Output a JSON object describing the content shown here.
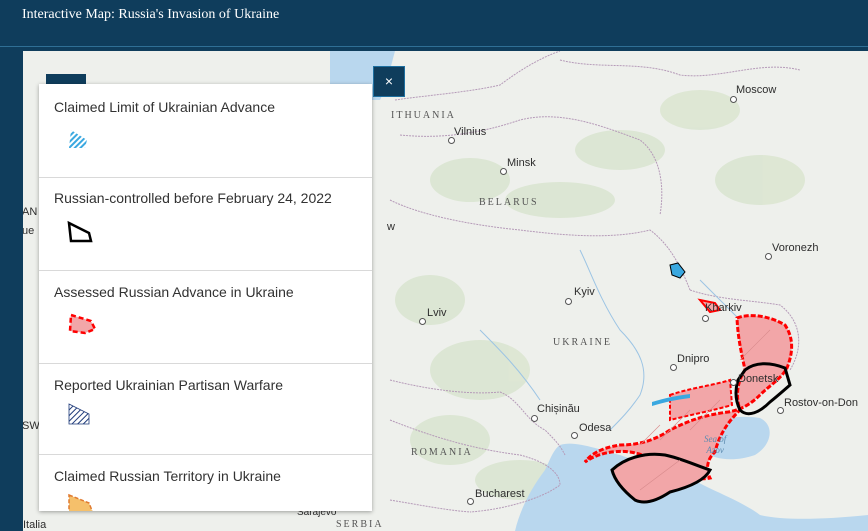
{
  "header": {
    "title": "Interactive Map: Russia's Invasion of Ukraine"
  },
  "legend": {
    "close_label": "×",
    "items": [
      {
        "label": "Claimed Limit of Ukrainian Advance",
        "swatch": "blue-hatched"
      },
      {
        "label": "Russian-controlled before February 24, 2022",
        "swatch": "black-outline"
      },
      {
        "label": "Assessed Russian Advance in Ukraine",
        "swatch": "red-fill"
      },
      {
        "label": "Reported Ukrainian Partisan Warfare",
        "swatch": "navy-hatched"
      },
      {
        "label": "Claimed Russian Territory in Ukraine",
        "swatch": "orange-fill"
      }
    ]
  },
  "map": {
    "cities": {
      "moscow": "Moscow",
      "vilnius": "Vilnius",
      "minsk": "Minsk",
      "voronezh": "Voronezh",
      "kyiv": "Kyiv",
      "lviv": "Lviv",
      "kharkiv": "Kharkiv",
      "dnipro": "Dnipro",
      "donetsk": "Donetsk",
      "rostov": "Rostov-on-Don",
      "chisinau": "Chișinău",
      "odesa": "Odesa",
      "bucharest": "Bucharest",
      "sarajevo": "Sarajevo"
    },
    "regions": {
      "lithuania": "ITHUANIA",
      "belarus": "BELARUS",
      "ukraine": "UKRAINE",
      "romania": "ROMANIA",
      "serbia": "SERBIA"
    },
    "seas": {
      "azov_line1": "Sea of",
      "azov_line2": "Azov"
    },
    "edge_fragments": {
      "left1": "AN",
      "left2": "ue",
      "left3": "SW",
      "left4": "Italia",
      "mid_w": "w"
    },
    "colors": {
      "russian_advance_fill": "#f2a6a8",
      "russian_advance_stroke": "#ff0000",
      "pre_invasion_stroke": "#000000",
      "ukrainian_advance": "#3aa8e0",
      "partisan": "#1f3b7a",
      "claimed_territory": "#f5c06b",
      "water": "#b9d7ee",
      "header": "#0f3d5c"
    }
  }
}
